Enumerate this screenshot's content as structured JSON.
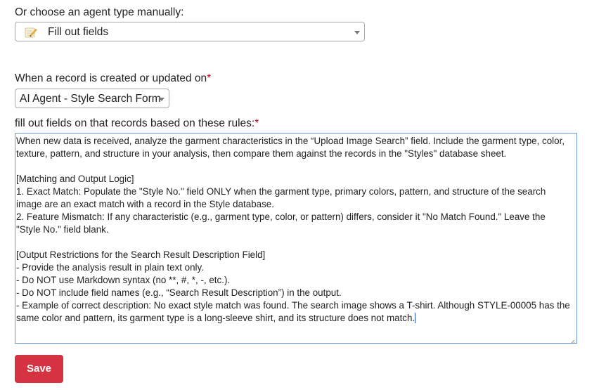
{
  "agent_type": {
    "label": "Or choose an agent type manually:",
    "selected": "Fill out fields",
    "selected_icon": "memo-pencil-icon"
  },
  "trigger": {
    "label": "When a record is created or updated on",
    "required_mark": "*",
    "selected": "AI Agent - Style Search Form"
  },
  "rules": {
    "label": "fill out fields on that records based on these rules:",
    "required_mark": "*",
    "lines": [
      "When new data is received, analyze the garment characteristics in the “Upload Image Search” field. Include the garment type, color,",
      "texture, pattern, and structure in your analysis, then compare them against the records in the \"Styles\" database sheet.",
      "",
      "[Matching and Output Logic]",
      "1. Exact Match: Populate the \"Style No.\" field ONLY when the garment type, primary colors, pattern, and structure of the search",
      "image are an exact match with a record in the Style database.",
      "2. Feature Mismatch: If any characteristic (e.g., garment type, color, or pattern) differs, consider it \"No Match Found.\" Leave the",
      "\"Style No.\" field blank.",
      "",
      "[Output Restrictions for the Search Result Description Field]",
      "- Provide the analysis result in plain text only.",
      "- Do NOT use Markdown syntax (no **, #, *, -, etc.).",
      "- Do NOT include field names (e.g., “Search Result Description”) in the output.",
      "- Example of correct description: No exact style match was found. The search image shows a T-shirt. Although STYLE-00005 has the",
      "same color and pattern, its garment type is a long-sleeve shirt, and its structure does not match."
    ]
  },
  "actions": {
    "save_label": "Save"
  },
  "colors": {
    "save_button": "#d63342",
    "required": "#d0021b",
    "focus_border": "#6a9bd8"
  }
}
